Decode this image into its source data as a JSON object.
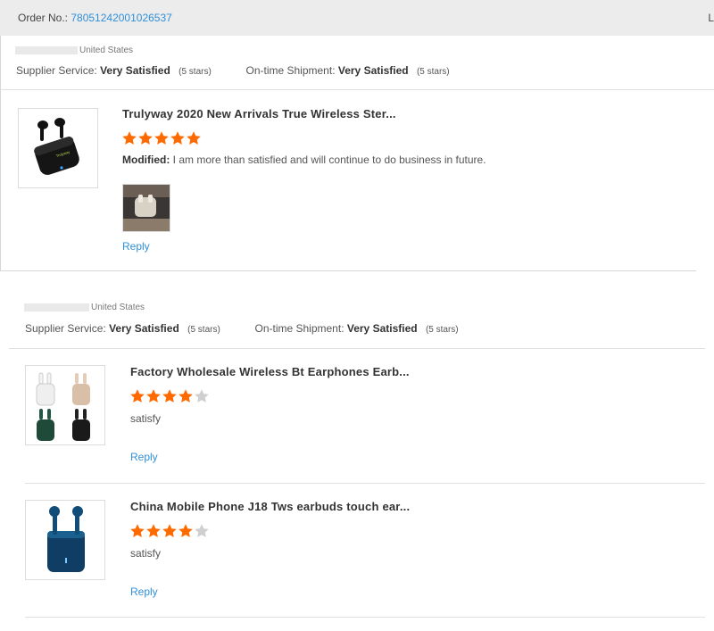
{
  "order": {
    "label": "Order No.:",
    "number": "78051242001026537",
    "cut_text": "L"
  },
  "reviews": [
    {
      "country": "United States",
      "supplier_label": "Supplier Service:",
      "supplier_value": "Very Satisfied",
      "supplier_stars": "(5 stars)",
      "shipment_label": "On-time Shipment:",
      "shipment_value": "Very Satisfied",
      "shipment_stars": "(5 stars)",
      "items": [
        {
          "title": "Trulyway 2020 New Arrivals True Wireless Ster...",
          "rating": 5,
          "comment_prefix": "Modified:",
          "comment": " I am more than satisfied and will continue to do business in future.",
          "reply": "Reply"
        }
      ]
    },
    {
      "country": "United States",
      "supplier_label": "Supplier Service:",
      "supplier_value": "Very Satisfied",
      "supplier_stars": "(5 stars)",
      "shipment_label": "On-time Shipment:",
      "shipment_value": "Very Satisfied",
      "shipment_stars": "(5 stars)",
      "items": [
        {
          "title": "Factory Wholesale Wireless Bt Earphones Earb...",
          "rating": 4,
          "comment": "satisfy",
          "reply": "Reply"
        },
        {
          "title": "China Mobile Phone J18 Tws earbuds touch ear...",
          "rating": 4,
          "comment": "satisfy",
          "reply": "Reply"
        }
      ]
    }
  ],
  "colors": {
    "star_on": "#ff6a00",
    "star_off": "#cfcfcf",
    "link": "#2f8fd8"
  }
}
